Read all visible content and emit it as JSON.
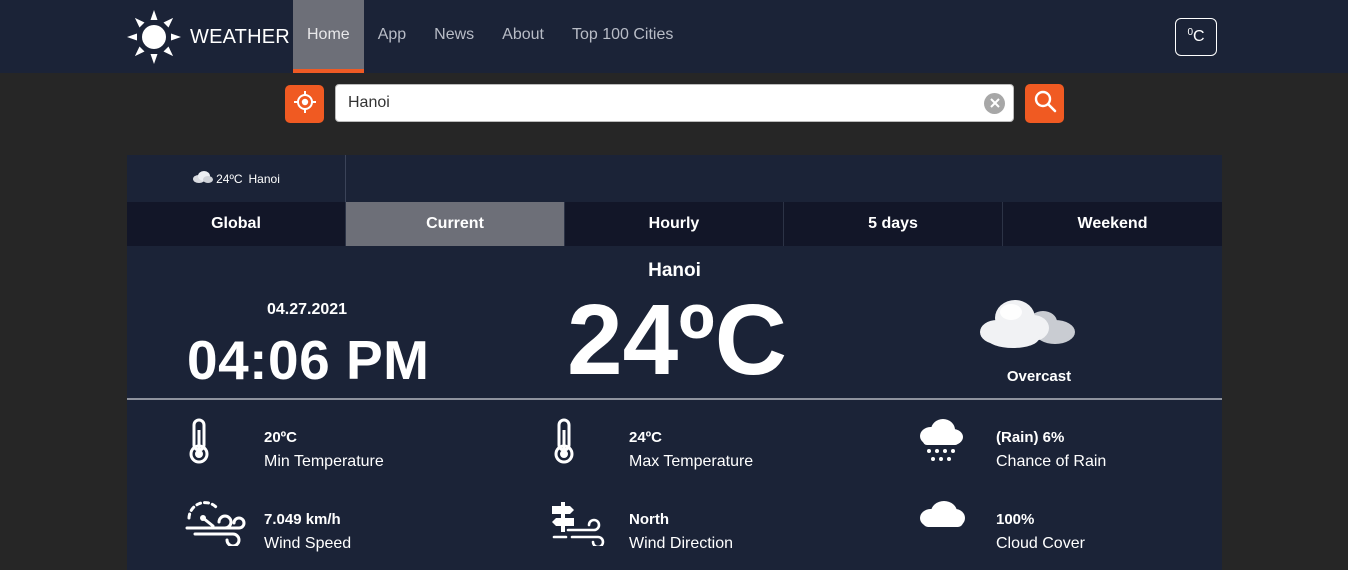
{
  "brand": {
    "name": "WEATHER",
    "icon": "sun-icon"
  },
  "nav": {
    "items": [
      {
        "label": "Home",
        "active": true
      },
      {
        "label": "App"
      },
      {
        "label": "News"
      },
      {
        "label": "About"
      },
      {
        "label": "Top 100 Cities"
      }
    ],
    "unit_base": "0",
    "unit_suffix": "C"
  },
  "search": {
    "value": "Hanoi",
    "locate_icon": "crosshair-icon",
    "clear_icon": "close-icon",
    "search_icon": "search-icon"
  },
  "location_tab": {
    "temp": "24ºC",
    "city": "Hanoi"
  },
  "tabs": [
    "Global",
    "Current",
    "Hourly",
    "5 days",
    "Weekend"
  ],
  "current": {
    "city": "Hanoi",
    "date": "04.27.2021",
    "time": "04:06 PM",
    "temperature": "24ºC",
    "condition": "Overcast"
  },
  "stats": [
    {
      "value": "20ºC",
      "label": "Min Temperature",
      "icon": "thermometer-icon"
    },
    {
      "value": "24ºC",
      "label": "Max Temperature",
      "icon": "thermometer-icon"
    },
    {
      "value": "(Rain) 6%",
      "label": "Chance of Rain",
      "icon": "rain-cloud-icon"
    },
    {
      "value": "7.049 km/h",
      "label": "Wind Speed",
      "icon": "wind-gauge-icon"
    },
    {
      "value": "North",
      "label": "Wind Direction",
      "icon": "signpost-wind-icon"
    },
    {
      "value": "100%",
      "label": "Cloud Cover",
      "icon": "cloud-icon"
    }
  ],
  "colors": {
    "navbar": "#1b2337",
    "accent": "#ef5a24",
    "panel": "#1b2337",
    "active_tab": "#6d6f78",
    "background": "#262626"
  }
}
